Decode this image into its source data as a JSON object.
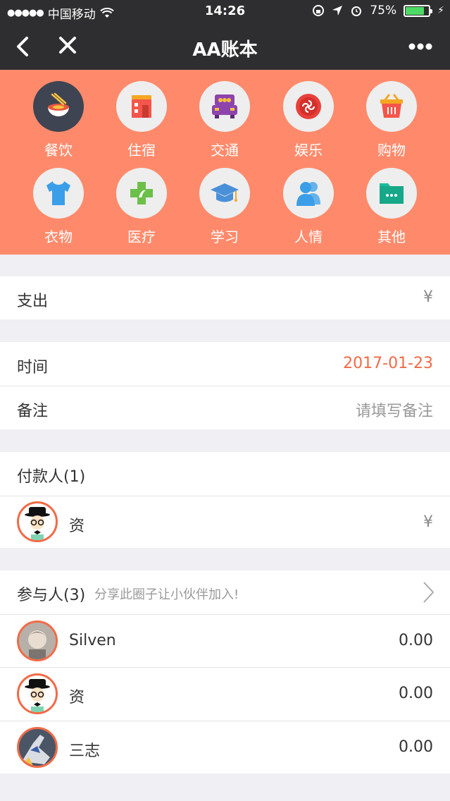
{
  "status_bar": {
    "carrier": "中国移动",
    "time": "14:26",
    "battery": "75%",
    "battery_level": 0.75
  },
  "nav": {
    "back_icon": "chevron-left-icon",
    "close_icon": "close-icon",
    "title": "AA账本",
    "more_icon": "more-icon"
  },
  "categories": [
    {
      "label": "餐饮",
      "icon": "noodles-icon"
    },
    {
      "label": "住宿",
      "icon": "building-icon"
    },
    {
      "label": "交通",
      "icon": "car-icon"
    },
    {
      "label": "娱乐",
      "icon": "entertainment-icon"
    },
    {
      "label": "购物",
      "icon": "shopping-basket-icon"
    },
    {
      "label": "衣物",
      "icon": "tshirt-icon"
    },
    {
      "label": "医疗",
      "icon": "medical-cross-icon"
    },
    {
      "label": "学习",
      "icon": "graduation-cap-icon"
    },
    {
      "label": "人情",
      "icon": "people-icon"
    },
    {
      "label": "其他",
      "icon": "folder-icon"
    }
  ],
  "expense": {
    "label": "支出",
    "currency": "¥"
  },
  "time_row": {
    "label": "时间",
    "value": "2017-01-23"
  },
  "note_row": {
    "label": "备注",
    "placeholder": "请填写备注"
  },
  "payers": {
    "header": "付款人(1)",
    "items": [
      {
        "name": "资",
        "currency": "¥"
      }
    ]
  },
  "participants": {
    "header": "参与人(3)",
    "hint": "分享此圈子让小伙伴加入!",
    "items": [
      {
        "name": "Silven",
        "amount": "0.00"
      },
      {
        "name": "资",
        "amount": "0.00"
      },
      {
        "name": "三志",
        "amount": "0.00"
      }
    ]
  },
  "colors": {
    "accent": "#ff8a6b",
    "date": "#f26a46",
    "nav_bg": "#2e2e30"
  }
}
